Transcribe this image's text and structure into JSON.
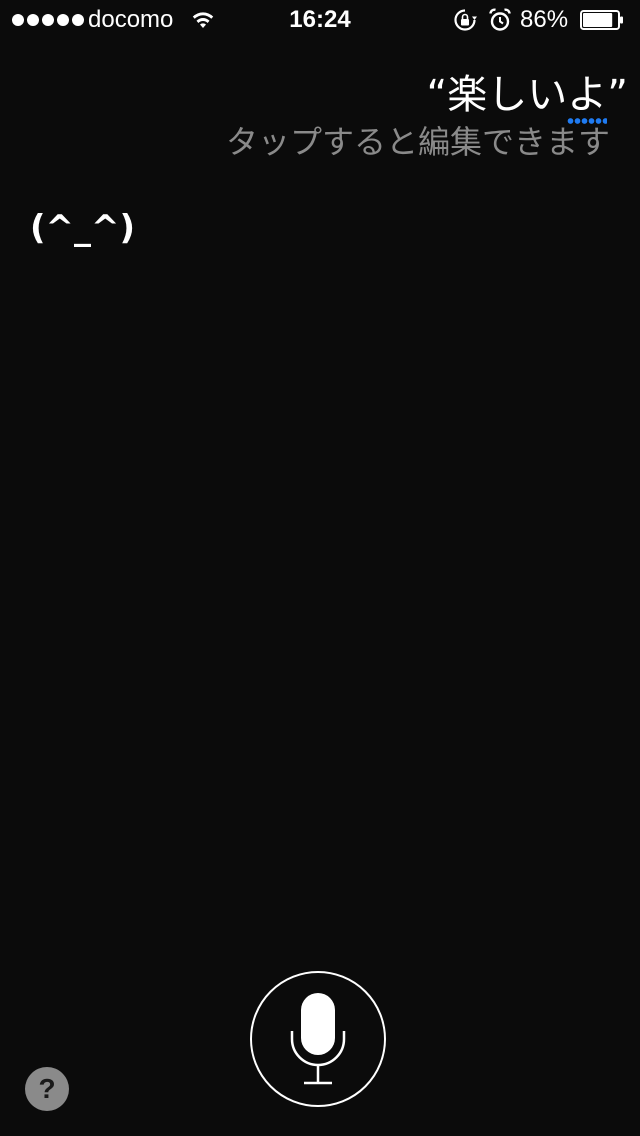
{
  "status_bar": {
    "signal_bars": 5,
    "carrier": "docomo",
    "wifi_icon": "wifi-icon",
    "time": "16:24",
    "rotation_lock_icon": "rotation-lock-icon",
    "alarm_icon": "alarm-icon",
    "battery_percent": "86%",
    "battery_level": 0.86
  },
  "siri": {
    "utterance_open_quote": "“",
    "utterance_main": "楽しい",
    "utterance_marked": "よ",
    "utterance_close_quote": "”",
    "marked_underline_color": "#1f7bf2",
    "edit_hint": "タップすると編集できます",
    "response": "(^_^)"
  },
  "controls": {
    "mic_icon": "microphone-icon",
    "help_label": "?"
  },
  "colors": {
    "background": "#0b0b0b",
    "text_primary": "#ffffff",
    "text_secondary": "#8a8a8a",
    "help_button_bg": "#8a8a8a"
  }
}
